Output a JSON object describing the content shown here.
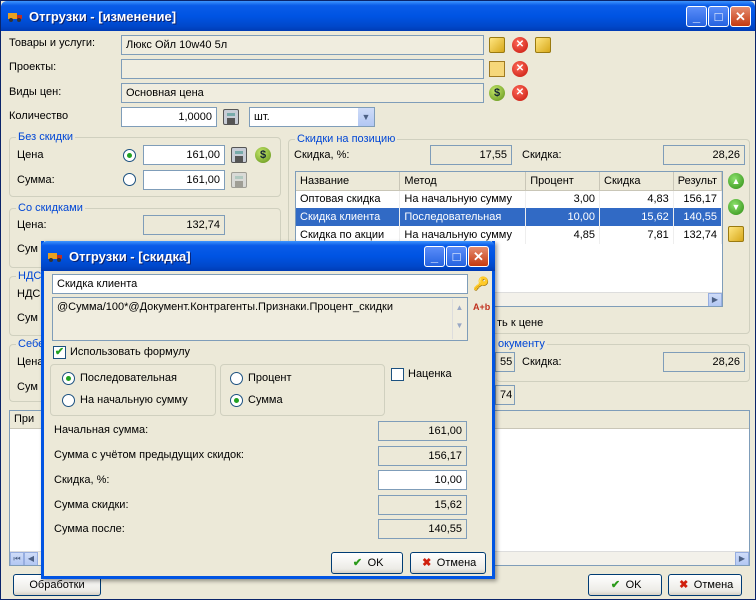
{
  "window": {
    "title": "Отгрузки - [изменение]"
  },
  "rows": {
    "goods_label": "Товары и услуги:",
    "goods_value": "Люкс Ойл 10w40 5л",
    "projects_label": "Проекты:",
    "projects_value": "",
    "price_types_label": "Виды цен:",
    "price_types_value": "Основная цена",
    "qty_label": "Количество",
    "qty_value": "1,0000",
    "unit_value": "шт."
  },
  "no_discount": {
    "title": "Без скидки",
    "price_label": "Цена",
    "price_value": "161,00",
    "sum_label": "Сумма:",
    "sum_value": "161,00"
  },
  "with_discount": {
    "title": "Со скидками",
    "price_label": "Цена:",
    "price_value": "132,74",
    "sum_label_partial": "Сум"
  },
  "vat": {
    "title_partial": "НДС",
    "label_partial": "НДС",
    "sum_partial": "Сум"
  },
  "cost": {
    "title_partial": "Себе",
    "price_partial": "Цена",
    "sum_partial": "Сум",
    "value_partial": "74"
  },
  "attrs_header_partial": "При",
  "position_discounts": {
    "title": "Скидки на позицию",
    "pct_label": "Скидка, %:",
    "pct_value": "17,55",
    "disc_label": "Скидка:",
    "disc_value": "28,26",
    "columns": [
      "Название",
      "Метод",
      "Процент",
      "Скидка",
      "Результ"
    ],
    "rows": [
      {
        "name": "Оптовая скидка",
        "method": "На начальную сумму",
        "pct": "3,00",
        "disc": "4,83",
        "res": "156,17"
      },
      {
        "name": "Скидка клиента",
        "method": "Последовательная",
        "pct": "10,00",
        "disc": "15,62",
        "res": "140,55"
      },
      {
        "name": "Скидка по акции",
        "method": "На начальную сумму",
        "pct": "4,85",
        "disc": "7,81",
        "res": "132,74"
      }
    ],
    "apply_partial": "ть к цене"
  },
  "doc_discounts": {
    "title_partial": "окументу",
    "val_partial": "55",
    "disc_label": "Скидка:",
    "disc_value": "28,26"
  },
  "footer": {
    "processing": "Обработки",
    "ok": "OK",
    "cancel": "Отмена"
  },
  "dialog": {
    "title": "Отгрузки - [скидка]",
    "name_value": "Скидка клиента",
    "formula_value": "@Сумма/100*@Документ.Контрагенты.Признаки.Процент_скидки",
    "use_formula": "Использовать формулу",
    "seq": "Последовательная",
    "on_start": "На начальную сумму",
    "percent": "Процент",
    "sum": "Сумма",
    "markup": "Наценка",
    "start_sum_label": "Начальная сумма:",
    "start_sum_value": "161,00",
    "prev_sum_label": "Сумма с учётом предыдущих скидок:",
    "prev_sum_value": "156,17",
    "pct_label": "Скидка, %:",
    "pct_value": "10,00",
    "disc_sum_label": "Сумма скидки:",
    "disc_sum_value": "15,62",
    "after_label": "Сумма после:",
    "after_value": "140,55",
    "ok": "OK",
    "cancel": "Отмена"
  }
}
